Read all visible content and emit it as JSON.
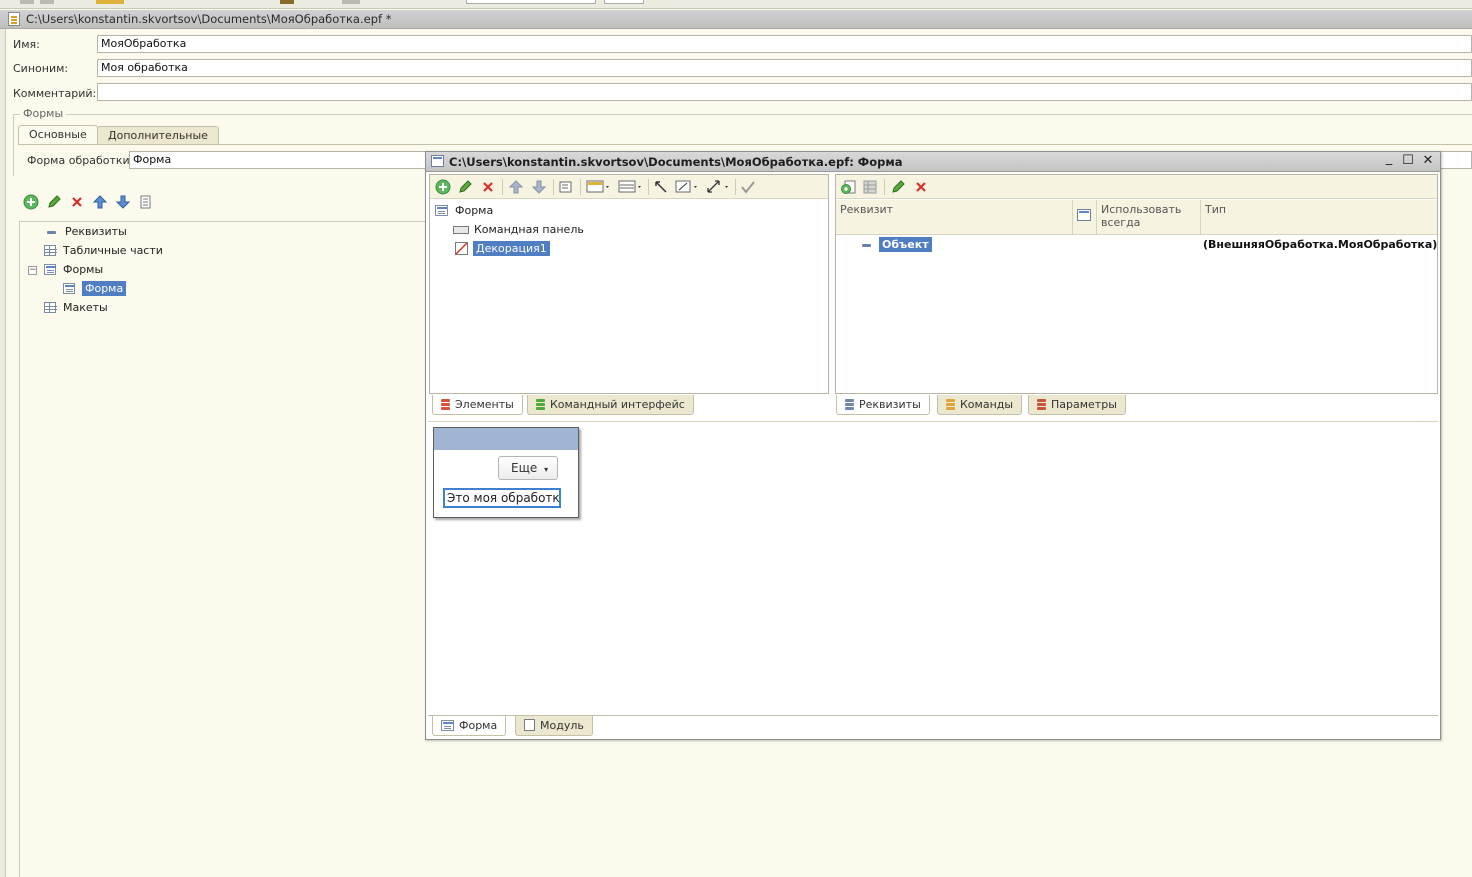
{
  "main": {
    "title": "C:\\Users\\konstantin.skvortsov\\Documents\\МояОбработка.epf *",
    "fields": {
      "name_label": "Имя:",
      "name_value": "МояОбработка",
      "synonym_label": "Синоним:",
      "synonym_value": "Моя обработка",
      "comment_label": "Комментарий:",
      "comment_value": ""
    },
    "forms_group": {
      "title": "Формы",
      "tabs": [
        "Основные",
        "Дополнительные"
      ],
      "form_label": "Форма обработки:",
      "form_value": "Форма"
    },
    "tree": {
      "items": [
        {
          "label": "Реквизиты",
          "icon": "attribute-icon"
        },
        {
          "label": "Табличные части",
          "icon": "table-icon"
        },
        {
          "label": "Формы",
          "icon": "form-icon"
        },
        {
          "label": "Форма",
          "icon": "form-icon",
          "selected": true
        },
        {
          "label": "Макеты",
          "icon": "template-icon"
        }
      ],
      "expander": "−"
    }
  },
  "form_editor": {
    "title": "C:\\Users\\konstantin.skvortsov\\Documents\\МояОбработка.epf: Форма",
    "elements_tree": {
      "root": "Форма",
      "children": [
        {
          "label": "Командная панель",
          "icon": "command-panel-icon"
        },
        {
          "label": "Декорация1",
          "icon": "decoration-icon",
          "selected": true
        }
      ]
    },
    "left_tabs": [
      "Элементы",
      "Командный интерфейс"
    ],
    "attributes_grid": {
      "columns": [
        "Реквизит",
        "Использовать всегда",
        "Тип"
      ],
      "rows": [
        {
          "name": "Объект",
          "type": "(ВнешняяОбработка.МояОбработка)",
          "selected": true
        }
      ]
    },
    "right_tabs": [
      "Реквизиты",
      "Команды",
      "Параметры"
    ],
    "preview": {
      "more_button": "Еще",
      "more_arrow": "▾",
      "decoration_text": "Это моя обработка"
    },
    "bottom_tabs": [
      "Форма",
      "Модуль"
    ],
    "window_controls": {
      "minimize": "_",
      "maximize": "☐",
      "close": "✕"
    }
  },
  "colors": {
    "background": "#FBFAEC",
    "selection": "#4F7EC2",
    "title_bar": "#C8C8C8",
    "preview_header": "#9FB5D3"
  }
}
